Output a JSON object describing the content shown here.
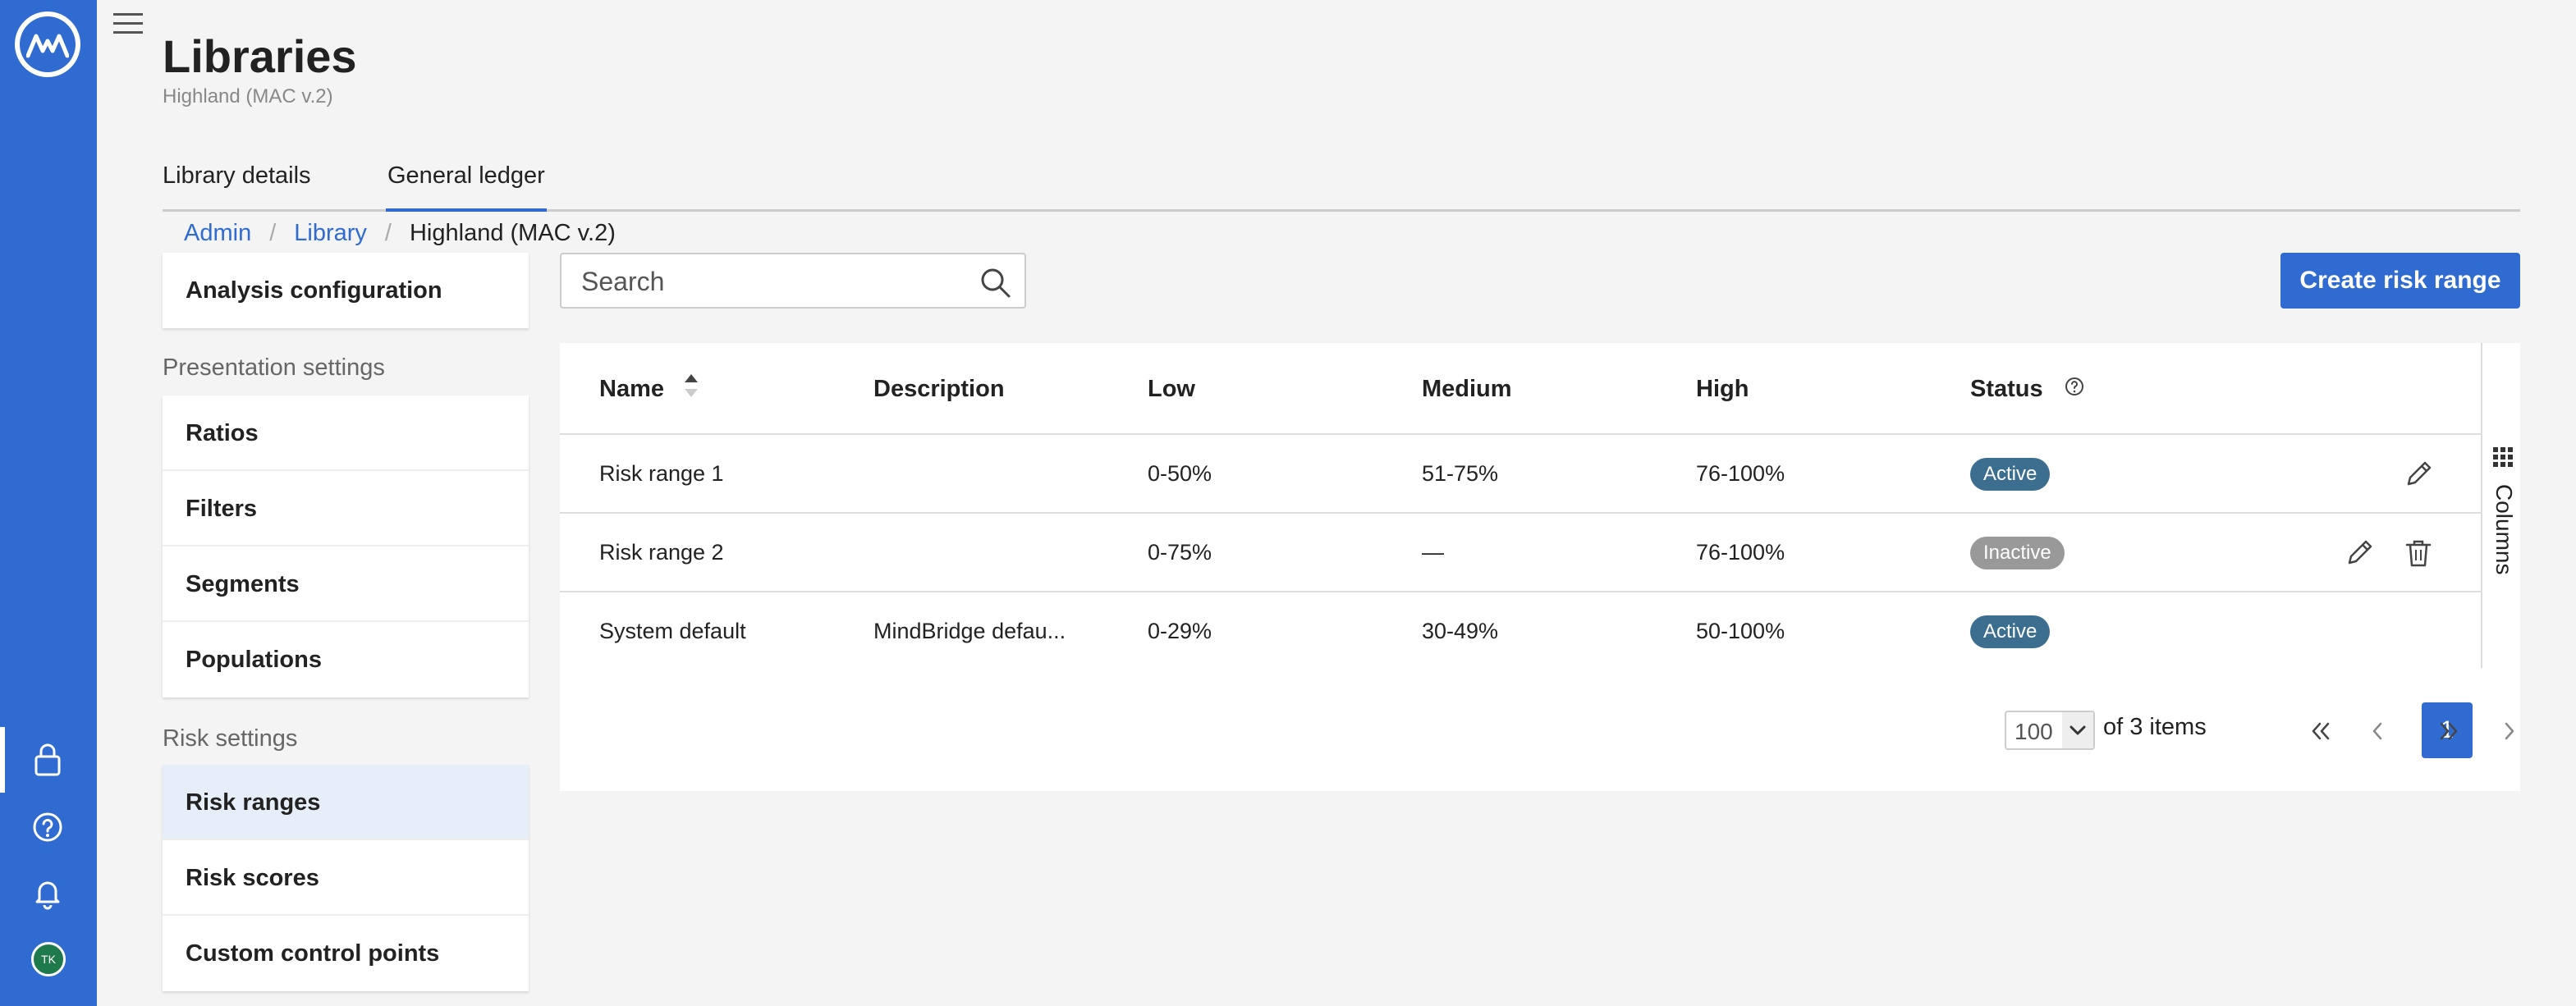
{
  "rail": {
    "avatar_initials": "TK",
    "icons": [
      "logo-icon",
      "lock-icon",
      "help-icon",
      "bell-icon",
      "avatar"
    ]
  },
  "page": {
    "title": "Libraries",
    "subtitle": "Highland (MAC v.2)"
  },
  "tabs": [
    {
      "label": "Library details",
      "active": false
    },
    {
      "label": "General ledger",
      "active": true
    }
  ],
  "breadcrumb": {
    "items": [
      "Admin",
      "Library"
    ],
    "current": "Highland (MAC v.2)"
  },
  "menu": {
    "top": [
      {
        "label": "Analysis configuration"
      }
    ],
    "presentation_label": "Presentation settings",
    "presentation": [
      {
        "label": "Ratios"
      },
      {
        "label": "Filters"
      },
      {
        "label": "Segments"
      },
      {
        "label": "Populations"
      }
    ],
    "risk_label": "Risk settings",
    "risk": [
      {
        "label": "Risk ranges",
        "selected": true
      },
      {
        "label": "Risk scores"
      },
      {
        "label": "Custom control points"
      }
    ]
  },
  "search": {
    "placeholder": "Search",
    "value": ""
  },
  "create_button": "Create risk range",
  "table": {
    "headers": [
      "Name",
      "Description",
      "Low",
      "Medium",
      "High",
      "Status"
    ],
    "rows": [
      {
        "name": "Risk range 1",
        "description": "",
        "low": "0-50%",
        "medium": "51-75%",
        "high": "76-100%",
        "status": "Active",
        "editable": true,
        "deletable": false
      },
      {
        "name": "Risk range 2",
        "description": "",
        "low": "0-75%",
        "medium": "—",
        "high": "76-100%",
        "status": "Inactive",
        "editable": true,
        "deletable": true
      },
      {
        "name": "System default",
        "description": "MindBridge defau...",
        "low": "0-29%",
        "medium": "30-49%",
        "high": "50-100%",
        "status": "Active",
        "editable": false,
        "deletable": false
      }
    ],
    "columns_label": "Columns"
  },
  "pagination": {
    "page_size": "100",
    "of_items": "of 3 items",
    "current_page": "1"
  },
  "colors": {
    "brand": "#2f6bd0",
    "active_badge": "#3c6e8f",
    "inactive_badge": "#999999",
    "selected_menu": "#e6eff9"
  }
}
